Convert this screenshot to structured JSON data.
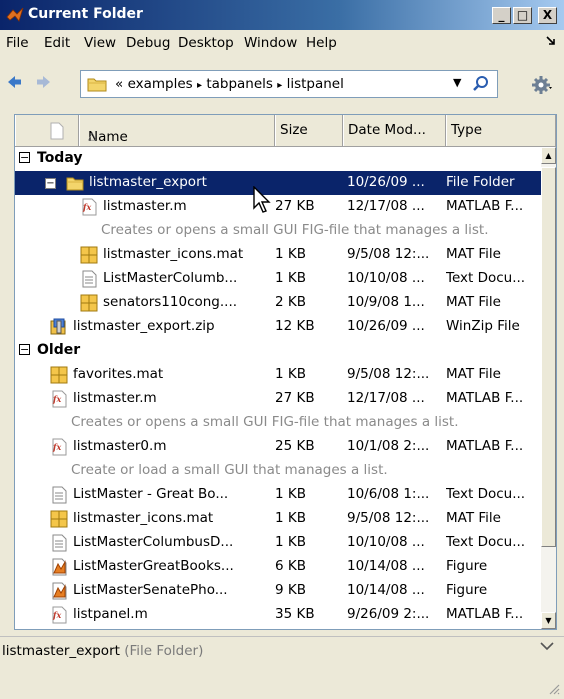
{
  "window": {
    "title": "Current Folder",
    "minimize": "_",
    "maximize": "□",
    "close": "X"
  },
  "menu": [
    "File",
    "Edit",
    "View",
    "Debug",
    "Desktop",
    "Window",
    "Help"
  ],
  "address": {
    "prefix": "«",
    "crumbs": [
      "examples",
      "tabpanels",
      "listpanel"
    ],
    "separator": "▸"
  },
  "columns": {
    "name": "Name",
    "sort_indicator": "△",
    "size": "Size",
    "date": "Date Mod...",
    "type": "Type"
  },
  "groups": [
    {
      "label": "Today",
      "toggle": "−",
      "rows": [
        {
          "kind": "item",
          "indent": 1,
          "expander": "−",
          "icon": "folder-icon",
          "name": "listmaster_export",
          "size": "",
          "date": "10/26/09 ...",
          "type": "File Folder",
          "selected": true
        },
        {
          "kind": "item",
          "indent": 2,
          "icon": "matlab-function-icon",
          "name": "listmaster.m",
          "size": "27 KB",
          "date": "12/17/08 ...",
          "type": "MATLAB F..."
        },
        {
          "kind": "desc",
          "indent": 2,
          "text": "Creates or opens a small GUI FIG-file that manages a list."
        },
        {
          "kind": "item",
          "indent": 2,
          "icon": "mat-file-icon",
          "name": "listmaster_icons.mat",
          "size": "1 KB",
          "date": "9/5/08 12:...",
          "type": "MAT File"
        },
        {
          "kind": "item",
          "indent": 2,
          "icon": "text-document-icon",
          "name": "ListMasterColumb...",
          "size": "1 KB",
          "date": "10/10/08 ...",
          "type": "Text Docu..."
        },
        {
          "kind": "item",
          "indent": 2,
          "icon": "mat-file-icon",
          "name": "senators110cong....",
          "size": "2 KB",
          "date": "10/9/08 1...",
          "type": "MAT File"
        },
        {
          "kind": "item",
          "indent": 1,
          "icon": "zip-file-icon",
          "name": "listmaster_export.zip",
          "size": "12 KB",
          "date": "10/26/09 ...",
          "type": "WinZip File"
        }
      ]
    },
    {
      "label": "Older",
      "toggle": "−",
      "rows": [
        {
          "kind": "item",
          "indent": 1,
          "icon": "mat-file-icon",
          "name": "favorites.mat",
          "size": "1 KB",
          "date": "9/5/08 12:...",
          "type": "MAT File"
        },
        {
          "kind": "item",
          "indent": 1,
          "icon": "matlab-function-icon",
          "name": "listmaster.m",
          "size": "27 KB",
          "date": "12/17/08 ...",
          "type": "MATLAB F..."
        },
        {
          "kind": "desc",
          "indent": 1,
          "text": "Creates or opens a small GUI FIG-file that manages a list."
        },
        {
          "kind": "item",
          "indent": 1,
          "icon": "matlab-function-icon",
          "name": "listmaster0.m",
          "size": "25 KB",
          "date": "10/1/08 2:...",
          "type": "MATLAB F..."
        },
        {
          "kind": "desc",
          "indent": 1,
          "text": "Create or load a small GUI that manages a list."
        },
        {
          "kind": "item",
          "indent": 1,
          "icon": "text-document-icon",
          "name": "ListMaster - Great Bo...",
          "size": "1 KB",
          "date": "10/6/08 1:...",
          "type": "Text Docu..."
        },
        {
          "kind": "item",
          "indent": 1,
          "icon": "mat-file-icon",
          "name": "listmaster_icons.mat",
          "size": "1 KB",
          "date": "9/5/08 12:...",
          "type": "MAT File"
        },
        {
          "kind": "item",
          "indent": 1,
          "icon": "text-document-icon",
          "name": "ListMasterColumbusD...",
          "size": "1 KB",
          "date": "10/10/08 ...",
          "type": "Text Docu..."
        },
        {
          "kind": "item",
          "indent": 1,
          "icon": "figure-file-icon",
          "name": "ListMasterGreatBooks...",
          "size": "6 KB",
          "date": "10/14/08 ...",
          "type": "Figure"
        },
        {
          "kind": "item",
          "indent": 1,
          "icon": "figure-file-icon",
          "name": "ListMasterSenatePho...",
          "size": "9 KB",
          "date": "10/14/08 ...",
          "type": "Figure"
        },
        {
          "kind": "item",
          "indent": 1,
          "icon": "matlab-function-icon",
          "name": "listpanel.m",
          "size": "35 KB",
          "date": "9/26/09 2:...",
          "type": "MATLAB F..."
        }
      ]
    }
  ],
  "status": {
    "name": "listmaster_export",
    "detail": "(File Folder)"
  },
  "colors": {
    "title_bar": "#0a246a",
    "selection": "#0a246a",
    "description_text": "#8a8a8a",
    "chrome": "#ece9d8"
  }
}
